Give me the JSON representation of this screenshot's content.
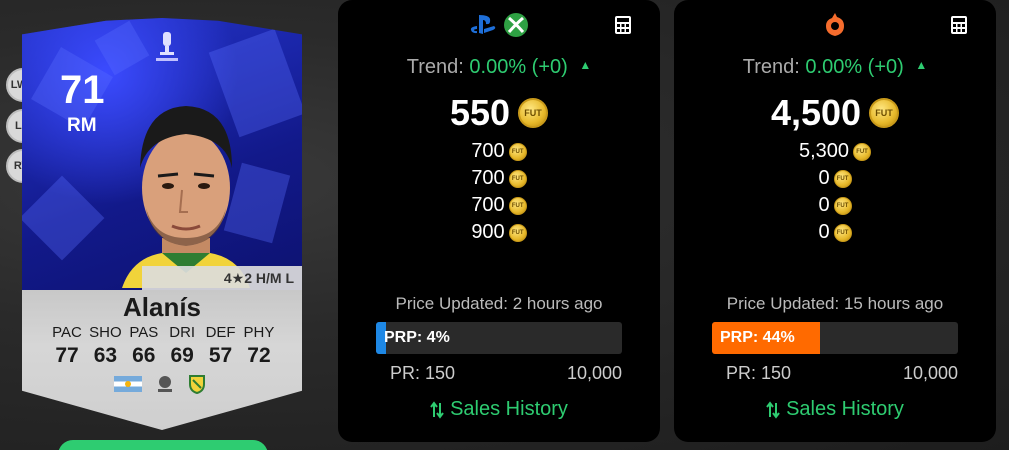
{
  "positions": [
    "LWB",
    "LM",
    "RW"
  ],
  "card": {
    "rating": "71",
    "position": "RM",
    "skills": "4★2 H/M L",
    "name": "Alanís",
    "stat_labels": [
      "PAC",
      "SHO",
      "PAS",
      "DRI",
      "DEF",
      "PHY"
    ],
    "stat_values": [
      "77",
      "63",
      "66",
      "69",
      "57",
      "72"
    ]
  },
  "coin_label": "FUT",
  "panels": [
    {
      "platforms": [
        "playstation-icon",
        "xbox-icon"
      ],
      "trend_label": "Trend:",
      "trend_value": "0.00% (+0)",
      "price": "550",
      "alt_prices": [
        "700",
        "700",
        "700",
        "900"
      ],
      "updated": "Price Updated: 2 hours ago",
      "prp_text": "PRP: 4%",
      "prp_percent": 4,
      "prp_color": "#1e88e5",
      "pr_min": "PR: 150",
      "pr_max": "10,000",
      "sales_history": "Sales History"
    },
    {
      "platforms": [
        "origin-icon"
      ],
      "trend_label": "Trend:",
      "trend_value": "0.00% (+0)",
      "price": "4,500",
      "alt_prices": [
        "5,300",
        "0",
        "0",
        "0"
      ],
      "updated": "Price Updated: 15 hours ago",
      "prp_text": "PRP: 44%",
      "prp_percent": 44,
      "prp_color": "#ff6a00",
      "pr_min": "PR: 150",
      "pr_max": "10,000",
      "sales_history": "Sales History"
    }
  ],
  "colors": {
    "accent_green": "#2ecc71",
    "panel_bg": "#000000",
    "card_blue": "#1a25a8"
  }
}
